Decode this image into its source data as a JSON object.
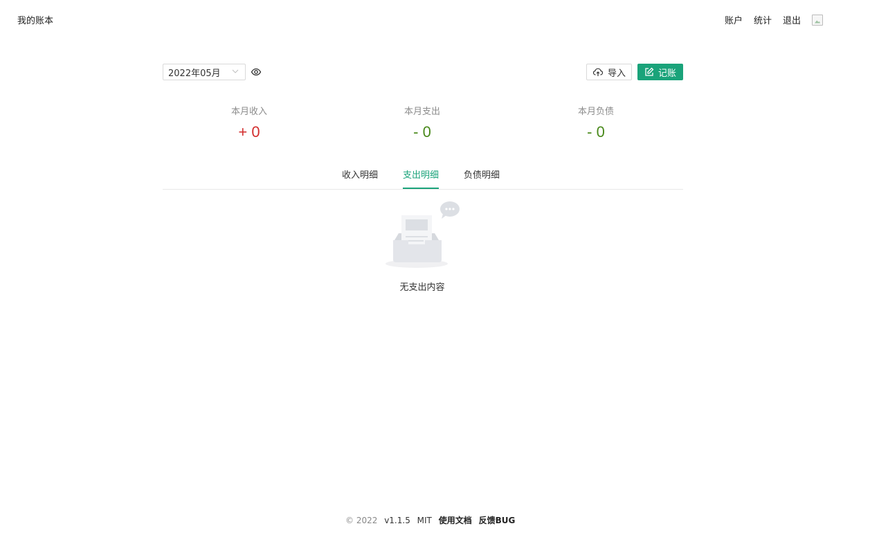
{
  "header": {
    "brand": "我的账本",
    "nav": [
      {
        "label": "账户"
      },
      {
        "label": "统计"
      },
      {
        "label": "退出"
      }
    ]
  },
  "toolbar": {
    "month_value": "2022年05月",
    "import_label": "导入",
    "record_label": "记账"
  },
  "stats": {
    "income": {
      "label": "本月收入",
      "value": "+ 0"
    },
    "expense": {
      "label": "本月支出",
      "value": "- 0"
    },
    "debt": {
      "label": "本月负债",
      "value": "- 0"
    }
  },
  "tabs": [
    {
      "label": "收入明细",
      "active": false
    },
    {
      "label": "支出明细",
      "active": true
    },
    {
      "label": "负债明细",
      "active": false
    }
  ],
  "empty_state": {
    "text": "无支出内容"
  },
  "footer": {
    "copyright": "© 2022",
    "version": "v1.1.5",
    "license": "MIT",
    "docs_label": "使用文档",
    "feedback_label": "反馈BUG"
  },
  "colors": {
    "accent": "#1aa37a",
    "income": "#d32f2f",
    "expense": "#4a8a1c"
  },
  "icons": {
    "eye": "eye-icon",
    "import": "cloud-upload-icon",
    "record": "edit-icon",
    "dropdown": "chevron-down-icon"
  }
}
